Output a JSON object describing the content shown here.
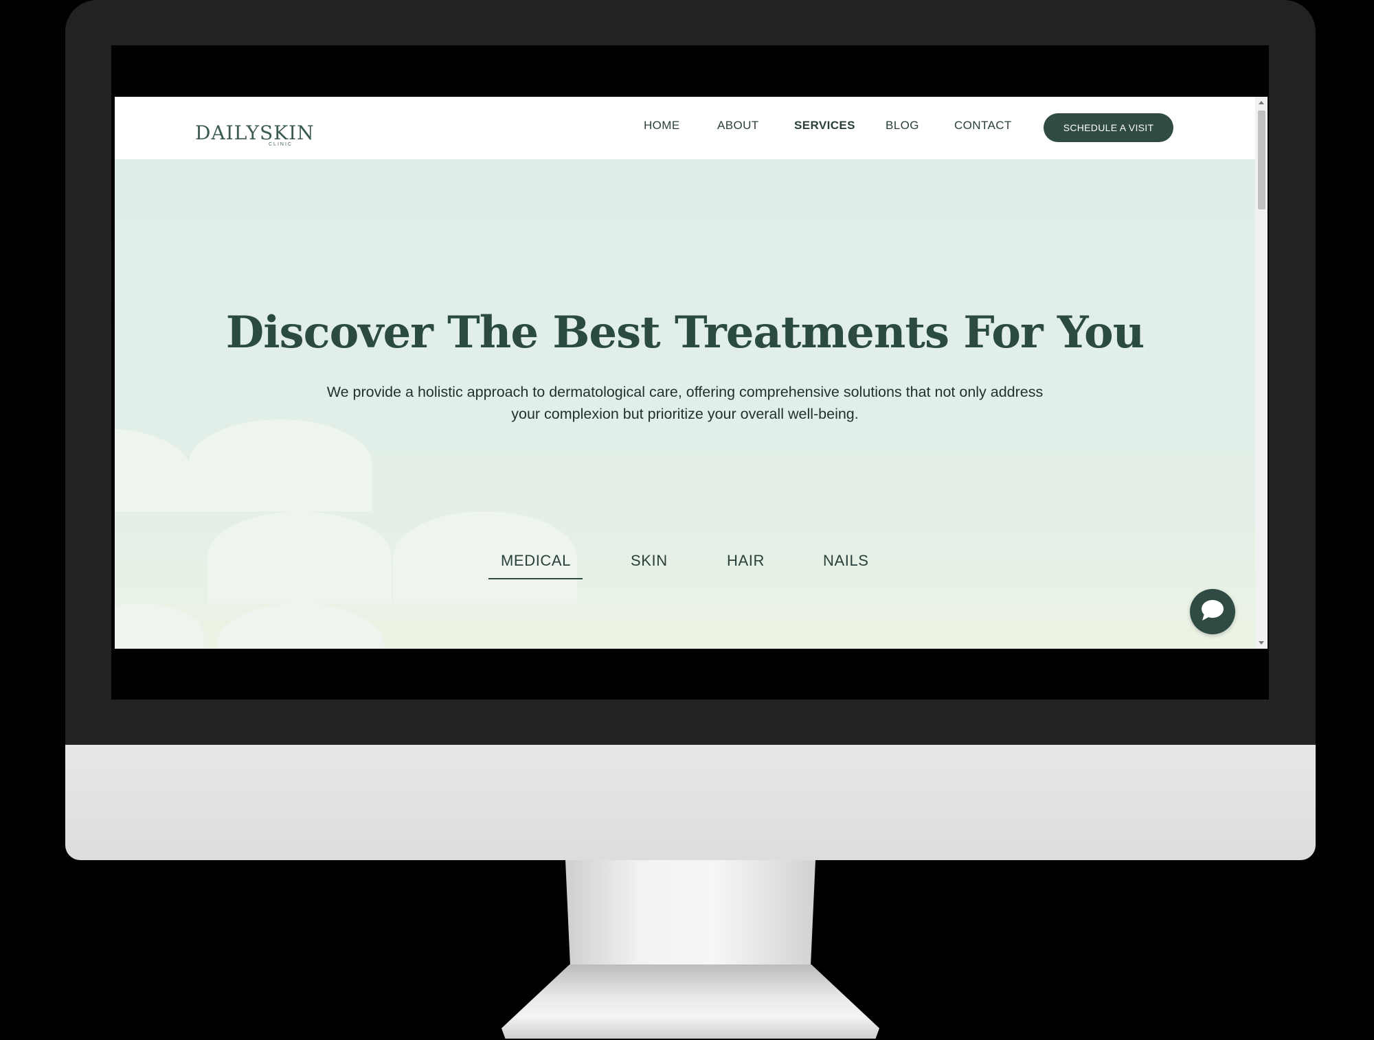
{
  "site": {
    "logo": {
      "name": "DAILYSKIN",
      "tagline": "CLINIC"
    },
    "nav": [
      {
        "label": "HOME"
      },
      {
        "label": "ABOUT"
      },
      {
        "label": "SERVICES",
        "active": true
      },
      {
        "label": "BLOG"
      },
      {
        "label": "CONTACT"
      }
    ],
    "cta_label": "SCHEDULE A VISIT"
  },
  "hero": {
    "title": "Discover The Best Treatments For You",
    "subtitle": "We provide a holistic approach to dermatological care, offering comprehensive solutions that not only address your complexion but prioritize your overall well-being.",
    "tabs": [
      {
        "label": "MEDICAL",
        "active": true
      },
      {
        "label": "SKIN"
      },
      {
        "label": "HAIR"
      },
      {
        "label": "NAILS"
      }
    ]
  },
  "colors": {
    "brand_dark": "#2f4b44",
    "hero_bg": "#e0eeea",
    "monitor_bezel": "#222222"
  },
  "icons": {
    "chat": "speech-bubble-icon"
  }
}
